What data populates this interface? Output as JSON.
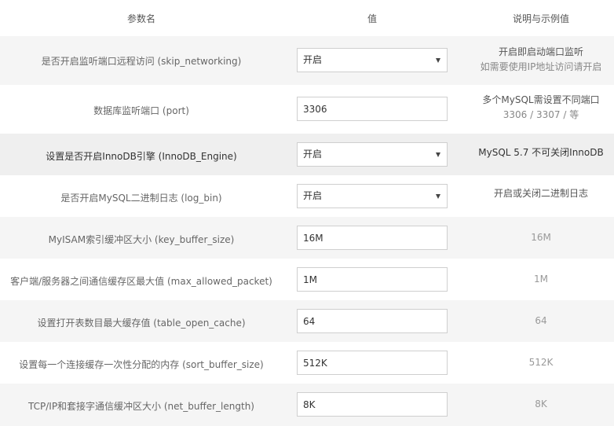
{
  "headers": {
    "param": "参数名",
    "value": "值",
    "desc": "说明与示例值"
  },
  "rows": [
    {
      "name": "是否开启监听端口远程访问 (skip_networking)",
      "value": "开启",
      "desc1": "开启即启动端口监听",
      "desc2": "如需要使用IP地址访问请开启"
    },
    {
      "name": "数据库监听端口 (port)",
      "value": "3306",
      "desc1": "多个MySQL需设置不同端口",
      "desc2": "3306 / 3307 / 等"
    },
    {
      "name": "设置是否开启InnoDB引擎 (InnoDB_Engine)",
      "value": "开启",
      "desc1": "MySQL 5.7 不可关闭InnoDB"
    },
    {
      "name": "是否开启MySQL二进制日志 (log_bin)",
      "value": "开启",
      "desc1": "开启或关闭二进制日志"
    },
    {
      "name": "MyISAM索引缓冲区大小 (key_buffer_size)",
      "value": "16M",
      "desc1": "16M"
    },
    {
      "name": "客户端/服务器之间通信缓存区最大值 (max_allowed_packet)",
      "value": "1M",
      "desc1": "1M"
    },
    {
      "name": "设置打开表数目最大缓存值 (table_open_cache)",
      "value": "64",
      "desc1": "64"
    },
    {
      "name": "设置每一个连接缓存一次性分配的内存 (sort_buffer_size)",
      "value": "512K",
      "desc1": "512K"
    },
    {
      "name": "TCP/IP和套接字通信缓冲区大小 (net_buffer_length)",
      "value": "8K",
      "desc1": "8K"
    }
  ]
}
